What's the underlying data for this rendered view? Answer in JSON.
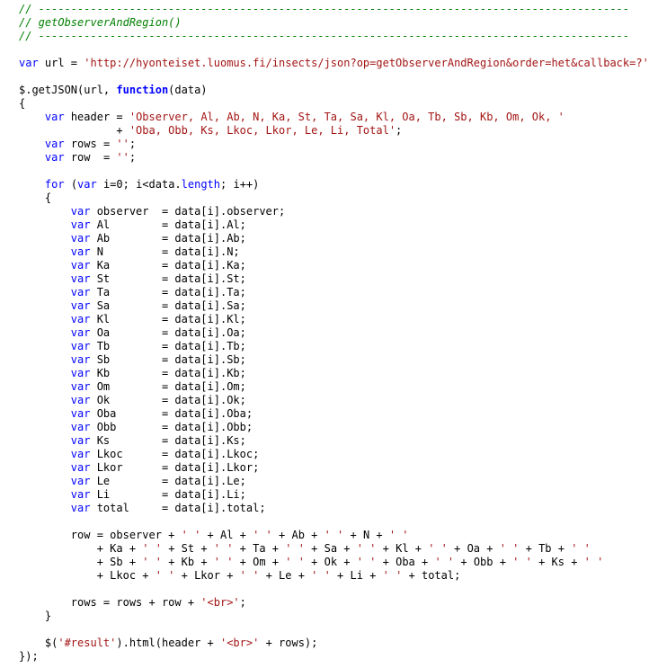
{
  "editor": {
    "colors": {
      "keyword": "#0000ff",
      "string": "#a31515",
      "comment": "#008000",
      "text": "#000000",
      "background": "#ffffff"
    },
    "lines": [
      [
        {
          "t": "cm",
          "v": "// -------------------------------------------------------------------------------------------"
        }
      ],
      [
        {
          "t": "cm",
          "v": "// getObserverAndRegion()"
        }
      ],
      [
        {
          "t": "cm",
          "v": "// -------------------------------------------------------------------------------------------"
        }
      ],
      [],
      [
        {
          "t": "kw",
          "v": "var"
        },
        {
          "t": "plain",
          "v": " url = "
        },
        {
          "t": "str",
          "v": "'http://hyonteiset.luomus.fi/insects/json?op=getObserverAndRegion&order=het&callback=?'"
        },
        {
          "t": "plain",
          "v": ";"
        }
      ],
      [],
      [
        {
          "t": "plain",
          "v": "$.getJSON(url, "
        },
        {
          "t": "kwb",
          "v": "function"
        },
        {
          "t": "plain",
          "v": "(data)"
        }
      ],
      [
        {
          "t": "plain",
          "v": "{"
        }
      ],
      [
        {
          "t": "plain",
          "v": "    "
        },
        {
          "t": "kw",
          "v": "var"
        },
        {
          "t": "plain",
          "v": " header = "
        },
        {
          "t": "str",
          "v": "'Observer, Al, Ab, N, Ka, St, Ta, Sa, Kl, Oa, Tb, Sb, Kb, Om, Ok, '"
        }
      ],
      [
        {
          "t": "plain",
          "v": "               + "
        },
        {
          "t": "str",
          "v": "'Oba, Obb, Ks, Lkoc, Lkor, Le, Li, Total'"
        },
        {
          "t": "plain",
          "v": ";"
        }
      ],
      [
        {
          "t": "plain",
          "v": "    "
        },
        {
          "t": "kw",
          "v": "var"
        },
        {
          "t": "plain",
          "v": " rows = "
        },
        {
          "t": "str",
          "v": "''"
        },
        {
          "t": "plain",
          "v": ";"
        }
      ],
      [
        {
          "t": "plain",
          "v": "    "
        },
        {
          "t": "kw",
          "v": "var"
        },
        {
          "t": "plain",
          "v": " row  = "
        },
        {
          "t": "str",
          "v": "''"
        },
        {
          "t": "plain",
          "v": ";"
        }
      ],
      [],
      [
        {
          "t": "plain",
          "v": "    "
        },
        {
          "t": "kw",
          "v": "for"
        },
        {
          "t": "plain",
          "v": " ("
        },
        {
          "t": "kw",
          "v": "var"
        },
        {
          "t": "plain",
          "v": " i=0; i<data."
        },
        {
          "t": "kw",
          "v": "length"
        },
        {
          "t": "plain",
          "v": "; i++)"
        }
      ],
      [
        {
          "t": "plain",
          "v": "    {"
        }
      ],
      [
        {
          "t": "plain",
          "v": "        "
        },
        {
          "t": "kw",
          "v": "var"
        },
        {
          "t": "plain",
          "v": " observer  = data[i].observer;"
        }
      ],
      [
        {
          "t": "plain",
          "v": "        "
        },
        {
          "t": "kw",
          "v": "var"
        },
        {
          "t": "plain",
          "v": " Al        = data[i].Al;"
        }
      ],
      [
        {
          "t": "plain",
          "v": "        "
        },
        {
          "t": "kw",
          "v": "var"
        },
        {
          "t": "plain",
          "v": " Ab        = data[i].Ab;"
        }
      ],
      [
        {
          "t": "plain",
          "v": "        "
        },
        {
          "t": "kw",
          "v": "var"
        },
        {
          "t": "plain",
          "v": " N         = data[i].N;"
        }
      ],
      [
        {
          "t": "plain",
          "v": "        "
        },
        {
          "t": "kw",
          "v": "var"
        },
        {
          "t": "plain",
          "v": " Ka        = data[i].Ka;"
        }
      ],
      [
        {
          "t": "plain",
          "v": "        "
        },
        {
          "t": "kw",
          "v": "var"
        },
        {
          "t": "plain",
          "v": " St        = data[i].St;"
        }
      ],
      [
        {
          "t": "plain",
          "v": "        "
        },
        {
          "t": "kw",
          "v": "var"
        },
        {
          "t": "plain",
          "v": " Ta        = data[i].Ta;"
        }
      ],
      [
        {
          "t": "plain",
          "v": "        "
        },
        {
          "t": "kw",
          "v": "var"
        },
        {
          "t": "plain",
          "v": " Sa        = data[i].Sa;"
        }
      ],
      [
        {
          "t": "plain",
          "v": "        "
        },
        {
          "t": "kw",
          "v": "var"
        },
        {
          "t": "plain",
          "v": " Kl        = data[i].Kl;"
        }
      ],
      [
        {
          "t": "plain",
          "v": "        "
        },
        {
          "t": "kw",
          "v": "var"
        },
        {
          "t": "plain",
          "v": " Oa        = data[i].Oa;"
        }
      ],
      [
        {
          "t": "plain",
          "v": "        "
        },
        {
          "t": "kw",
          "v": "var"
        },
        {
          "t": "plain",
          "v": " Tb        = data[i].Tb;"
        }
      ],
      [
        {
          "t": "plain",
          "v": "        "
        },
        {
          "t": "kw",
          "v": "var"
        },
        {
          "t": "plain",
          "v": " Sb        = data[i].Sb;"
        }
      ],
      [
        {
          "t": "plain",
          "v": "        "
        },
        {
          "t": "kw",
          "v": "var"
        },
        {
          "t": "plain",
          "v": " Kb        = data[i].Kb;"
        }
      ],
      [
        {
          "t": "plain",
          "v": "        "
        },
        {
          "t": "kw",
          "v": "var"
        },
        {
          "t": "plain",
          "v": " Om        = data[i].Om;"
        }
      ],
      [
        {
          "t": "plain",
          "v": "        "
        },
        {
          "t": "kw",
          "v": "var"
        },
        {
          "t": "plain",
          "v": " Ok        = data[i].Ok;"
        }
      ],
      [
        {
          "t": "plain",
          "v": "        "
        },
        {
          "t": "kw",
          "v": "var"
        },
        {
          "t": "plain",
          "v": " Oba       = data[i].Oba;"
        }
      ],
      [
        {
          "t": "plain",
          "v": "        "
        },
        {
          "t": "kw",
          "v": "var"
        },
        {
          "t": "plain",
          "v": " Obb       = data[i].Obb;"
        }
      ],
      [
        {
          "t": "plain",
          "v": "        "
        },
        {
          "t": "kw",
          "v": "var"
        },
        {
          "t": "plain",
          "v": " Ks        = data[i].Ks;"
        }
      ],
      [
        {
          "t": "plain",
          "v": "        "
        },
        {
          "t": "kw",
          "v": "var"
        },
        {
          "t": "plain",
          "v": " Lkoc      = data[i].Lkoc;"
        }
      ],
      [
        {
          "t": "plain",
          "v": "        "
        },
        {
          "t": "kw",
          "v": "var"
        },
        {
          "t": "plain",
          "v": " Lkor      = data[i].Lkor;"
        }
      ],
      [
        {
          "t": "plain",
          "v": "        "
        },
        {
          "t": "kw",
          "v": "var"
        },
        {
          "t": "plain",
          "v": " Le        = data[i].Le;"
        }
      ],
      [
        {
          "t": "plain",
          "v": "        "
        },
        {
          "t": "kw",
          "v": "var"
        },
        {
          "t": "plain",
          "v": " Li        = data[i].Li;"
        }
      ],
      [
        {
          "t": "plain",
          "v": "        "
        },
        {
          "t": "kw",
          "v": "var"
        },
        {
          "t": "plain",
          "v": " total     = data[i].total;"
        }
      ],
      [],
      [
        {
          "t": "plain",
          "v": "        row = observer + "
        },
        {
          "t": "str",
          "v": "' '"
        },
        {
          "t": "plain",
          "v": " + Al + "
        },
        {
          "t": "str",
          "v": "' '"
        },
        {
          "t": "plain",
          "v": " + Ab + "
        },
        {
          "t": "str",
          "v": "' '"
        },
        {
          "t": "plain",
          "v": " + N + "
        },
        {
          "t": "str",
          "v": "' '"
        }
      ],
      [
        {
          "t": "plain",
          "v": "            + Ka + "
        },
        {
          "t": "str",
          "v": "' '"
        },
        {
          "t": "plain",
          "v": " + St + "
        },
        {
          "t": "str",
          "v": "' '"
        },
        {
          "t": "plain",
          "v": " + Ta + "
        },
        {
          "t": "str",
          "v": "' '"
        },
        {
          "t": "plain",
          "v": " + Sa + "
        },
        {
          "t": "str",
          "v": "' '"
        },
        {
          "t": "plain",
          "v": " + Kl + "
        },
        {
          "t": "str",
          "v": "' '"
        },
        {
          "t": "plain",
          "v": " + Oa + "
        },
        {
          "t": "str",
          "v": "' '"
        },
        {
          "t": "plain",
          "v": " + Tb + "
        },
        {
          "t": "str",
          "v": "' '"
        }
      ],
      [
        {
          "t": "plain",
          "v": "            + Sb + "
        },
        {
          "t": "str",
          "v": "' '"
        },
        {
          "t": "plain",
          "v": " + Kb + "
        },
        {
          "t": "str",
          "v": "' '"
        },
        {
          "t": "plain",
          "v": " + Om + "
        },
        {
          "t": "str",
          "v": "' '"
        },
        {
          "t": "plain",
          "v": " + Ok + "
        },
        {
          "t": "str",
          "v": "' '"
        },
        {
          "t": "plain",
          "v": " + Oba + "
        },
        {
          "t": "str",
          "v": "' '"
        },
        {
          "t": "plain",
          "v": " + Obb + "
        },
        {
          "t": "str",
          "v": "' '"
        },
        {
          "t": "plain",
          "v": " + Ks + "
        },
        {
          "t": "str",
          "v": "' '"
        }
      ],
      [
        {
          "t": "plain",
          "v": "            + Lkoc + "
        },
        {
          "t": "str",
          "v": "' '"
        },
        {
          "t": "plain",
          "v": " + Lkor + "
        },
        {
          "t": "str",
          "v": "' '"
        },
        {
          "t": "plain",
          "v": " + Le + "
        },
        {
          "t": "str",
          "v": "' '"
        },
        {
          "t": "plain",
          "v": " + Li + "
        },
        {
          "t": "str",
          "v": "' '"
        },
        {
          "t": "plain",
          "v": " + total;"
        }
      ],
      [],
      [
        {
          "t": "plain",
          "v": "        rows = rows + row + "
        },
        {
          "t": "str",
          "v": "'<br>'"
        },
        {
          "t": "plain",
          "v": ";"
        }
      ],
      [
        {
          "t": "plain",
          "v": "    }"
        }
      ],
      [],
      [
        {
          "t": "plain",
          "v": "    $("
        },
        {
          "t": "str",
          "v": "'#result'"
        },
        {
          "t": "plain",
          "v": ").html(header + "
        },
        {
          "t": "str",
          "v": "'<br>'"
        },
        {
          "t": "plain",
          "v": " + rows);"
        }
      ],
      [
        {
          "t": "plain",
          "v": "});"
        }
      ]
    ]
  }
}
